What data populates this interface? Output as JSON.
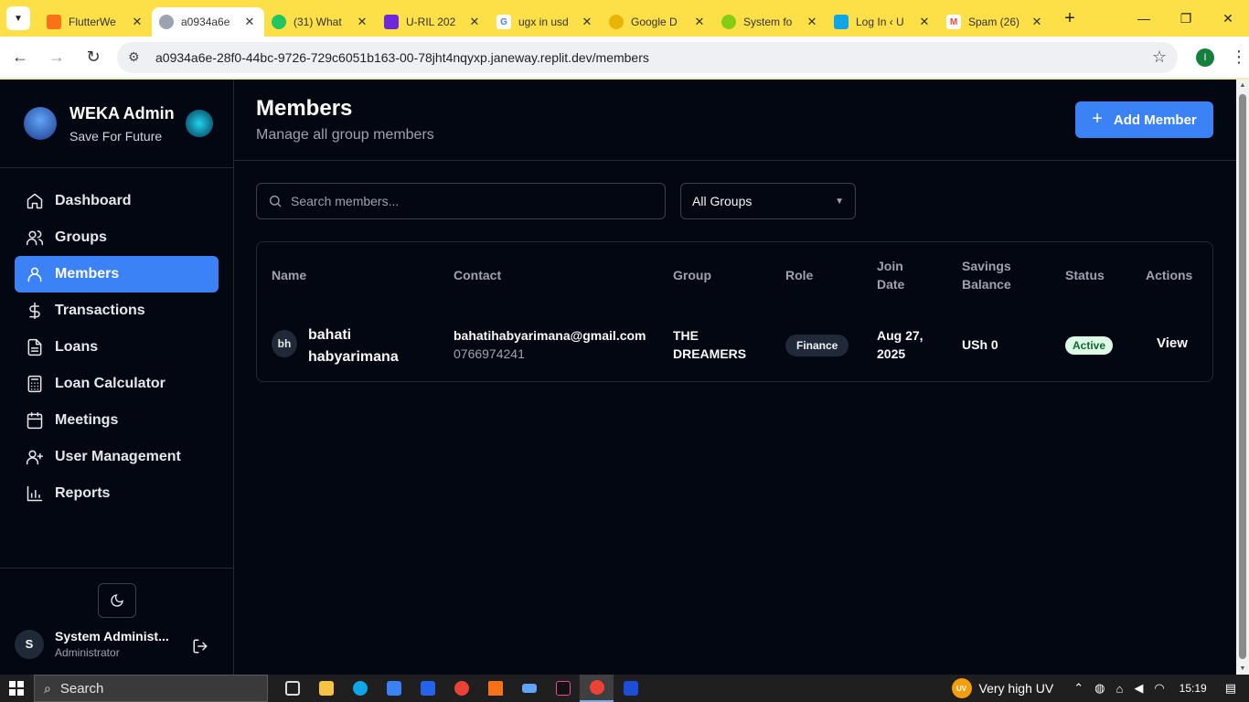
{
  "browser": {
    "tabs": [
      {
        "title": "FlutterWe",
        "color": "#f97316",
        "glyph": ""
      },
      {
        "title": "a0934a6e",
        "color": "#9ca3af",
        "glyph": "",
        "active": true
      },
      {
        "title": "(31) What",
        "color": "#22c55e",
        "glyph": ""
      },
      {
        "title": "U-RIL 202",
        "color": "#6d28d9",
        "glyph": ""
      },
      {
        "title": "ugx in usd",
        "color": "#ffffff",
        "glyph": "G"
      },
      {
        "title": "Google D",
        "color": "#eab308",
        "glyph": ""
      },
      {
        "title": "System fo",
        "color": "#84cc16",
        "glyph": ""
      },
      {
        "title": "Log In ‹ U",
        "color": "#0ea5e9",
        "glyph": ""
      },
      {
        "title": "Spam (26)",
        "color": "#ef4444",
        "glyph": "M"
      }
    ],
    "url": "a0934a6e-28f0-44bc-9726-729c6051b163-00-78jht4nqyxp.janeway.replit.dev/members",
    "profile_initial": "I"
  },
  "sidebar": {
    "brand_title": "WEKA Admin",
    "brand_subtitle": "Save For Future",
    "items": [
      {
        "label": "Dashboard",
        "icon": "home-icon"
      },
      {
        "label": "Groups",
        "icon": "users-icon"
      },
      {
        "label": "Members",
        "icon": "user-icon",
        "active": true
      },
      {
        "label": "Transactions",
        "icon": "dollar-icon"
      },
      {
        "label": "Loans",
        "icon": "document-icon"
      },
      {
        "label": "Loan Calculator",
        "icon": "calculator-icon"
      },
      {
        "label": "Meetings",
        "icon": "calendar-icon"
      },
      {
        "label": "User Management",
        "icon": "user-plus-icon"
      },
      {
        "label": "Reports",
        "icon": "bar-chart-icon"
      }
    ],
    "user": {
      "initial": "S",
      "name": "System Administ...",
      "role": "Administrator"
    }
  },
  "header": {
    "title": "Members",
    "subtitle": "Manage all group members",
    "add_label": "Add Member"
  },
  "filters": {
    "search_placeholder": "Search members...",
    "group_selected": "All Groups"
  },
  "table": {
    "columns": {
      "name": "Name",
      "contact": "Contact",
      "group": "Group",
      "role": "Role",
      "join_date": "Join Date",
      "savings": "Savings Balance",
      "status": "Status",
      "actions": "Actions"
    },
    "rows": [
      {
        "initials": "bh",
        "name": "bahati habyarimana",
        "email": "bahatihabyarimana@gmail.com",
        "phone": "0766974241",
        "group": "THE DREAMERS",
        "role": "Finance",
        "join_date": "Aug 27, 2025",
        "savings": "USh 0",
        "status": "Active",
        "action": "View"
      }
    ]
  },
  "taskbar": {
    "search_label": "Search",
    "weather": "Very high UV",
    "weather_badge": "UV",
    "time": "15:19"
  },
  "colors": {
    "accent": "#3b82f6",
    "background": "#030712",
    "status_active_bg": "#dcfce7",
    "status_active_text": "#166534"
  }
}
